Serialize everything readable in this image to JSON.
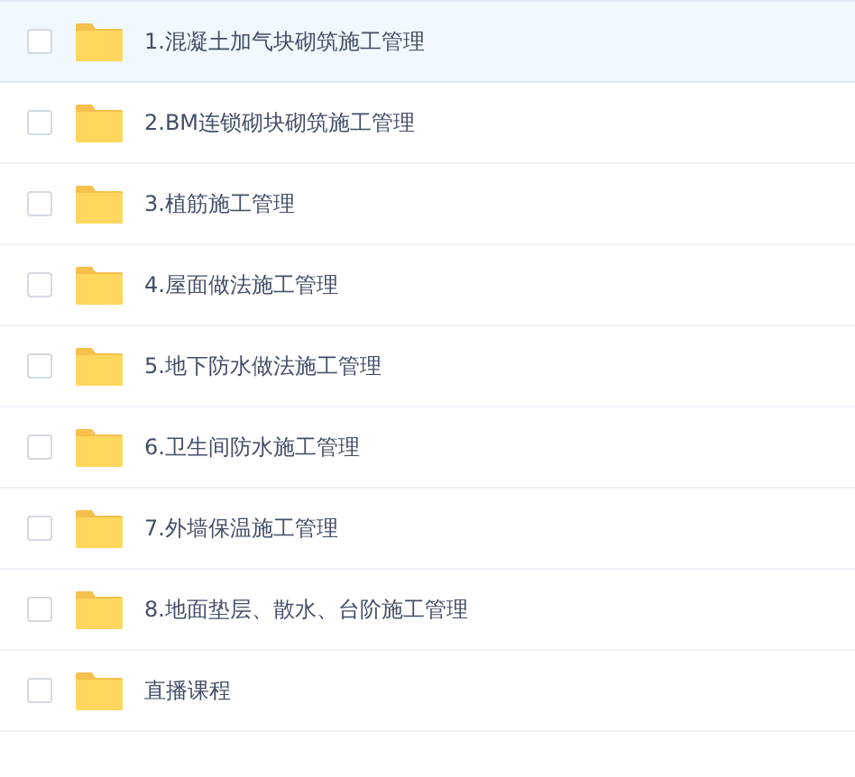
{
  "folders": [
    {
      "name": "1.混凝土加气块砌筑施工管理",
      "highlighted": true,
      "checked": false
    },
    {
      "name": "2.BM连锁砌块砌筑施工管理",
      "highlighted": false,
      "checked": false
    },
    {
      "name": "3.植筋施工管理",
      "highlighted": false,
      "checked": false
    },
    {
      "name": "4.屋面做法施工管理",
      "highlighted": false,
      "checked": false
    },
    {
      "name": "5.地下防水做法施工管理",
      "highlighted": false,
      "checked": false
    },
    {
      "name": "6.卫生间防水施工管理",
      "highlighted": false,
      "checked": false
    },
    {
      "name": "7.外墙保温施工管理",
      "highlighted": false,
      "checked": false
    },
    {
      "name": "8.地面垫层、散水、台阶施工管理",
      "highlighted": false,
      "checked": false
    },
    {
      "name": "直播课程",
      "highlighted": false,
      "checked": false
    }
  ]
}
